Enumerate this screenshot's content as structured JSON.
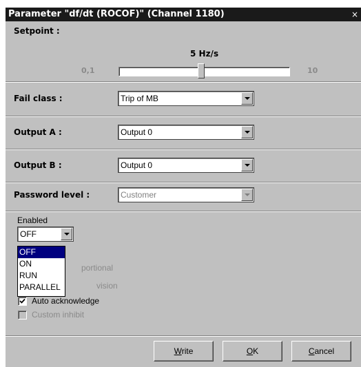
{
  "window": {
    "title": "Parameter \"df/dt (ROCOF)\" (Channel 1180)",
    "close_glyph": "×"
  },
  "setpoint": {
    "label": "Setpoint :",
    "value_text": "5 Hz/s",
    "min_text": "0,1",
    "max_text": "10",
    "level": 5
  },
  "fail_class": {
    "label": "Fail class :",
    "value": "Trip of MB"
  },
  "output_a": {
    "label": "Output A :",
    "value": "Output 0"
  },
  "output_b": {
    "label": "Output B :",
    "value": "Output 0"
  },
  "password_level": {
    "label": "Password level :",
    "value": "Customer"
  },
  "enabled": {
    "label": "Enabled",
    "value": "OFF",
    "options": [
      "OFF",
      "ON",
      "RUN",
      "PARALLEL"
    ],
    "selected_index": 0
  },
  "checkboxes": {
    "proportional_partial": "portional",
    "supervision_partial": "vision",
    "auto_acknowledge": {
      "label": "Auto acknowledge",
      "checked": true
    },
    "custom_inhibit": {
      "label": "Custom inhibit",
      "checked": false
    }
  },
  "buttons": {
    "write": {
      "mnemonic": "W",
      "rest": "rite"
    },
    "ok": {
      "mnemonic": "O",
      "rest": "K"
    },
    "cancel": {
      "mnemonic": "C",
      "rest": "ancel"
    }
  },
  "colors": {
    "title_bg": "#1a1a1a",
    "dialog_bg": "#c0c0c0",
    "selection": "#000080",
    "disabled_text": "#808080"
  },
  "icons": {
    "close": "close-icon",
    "dropdown": "chevron-down-icon",
    "check": "checkmark-icon"
  }
}
